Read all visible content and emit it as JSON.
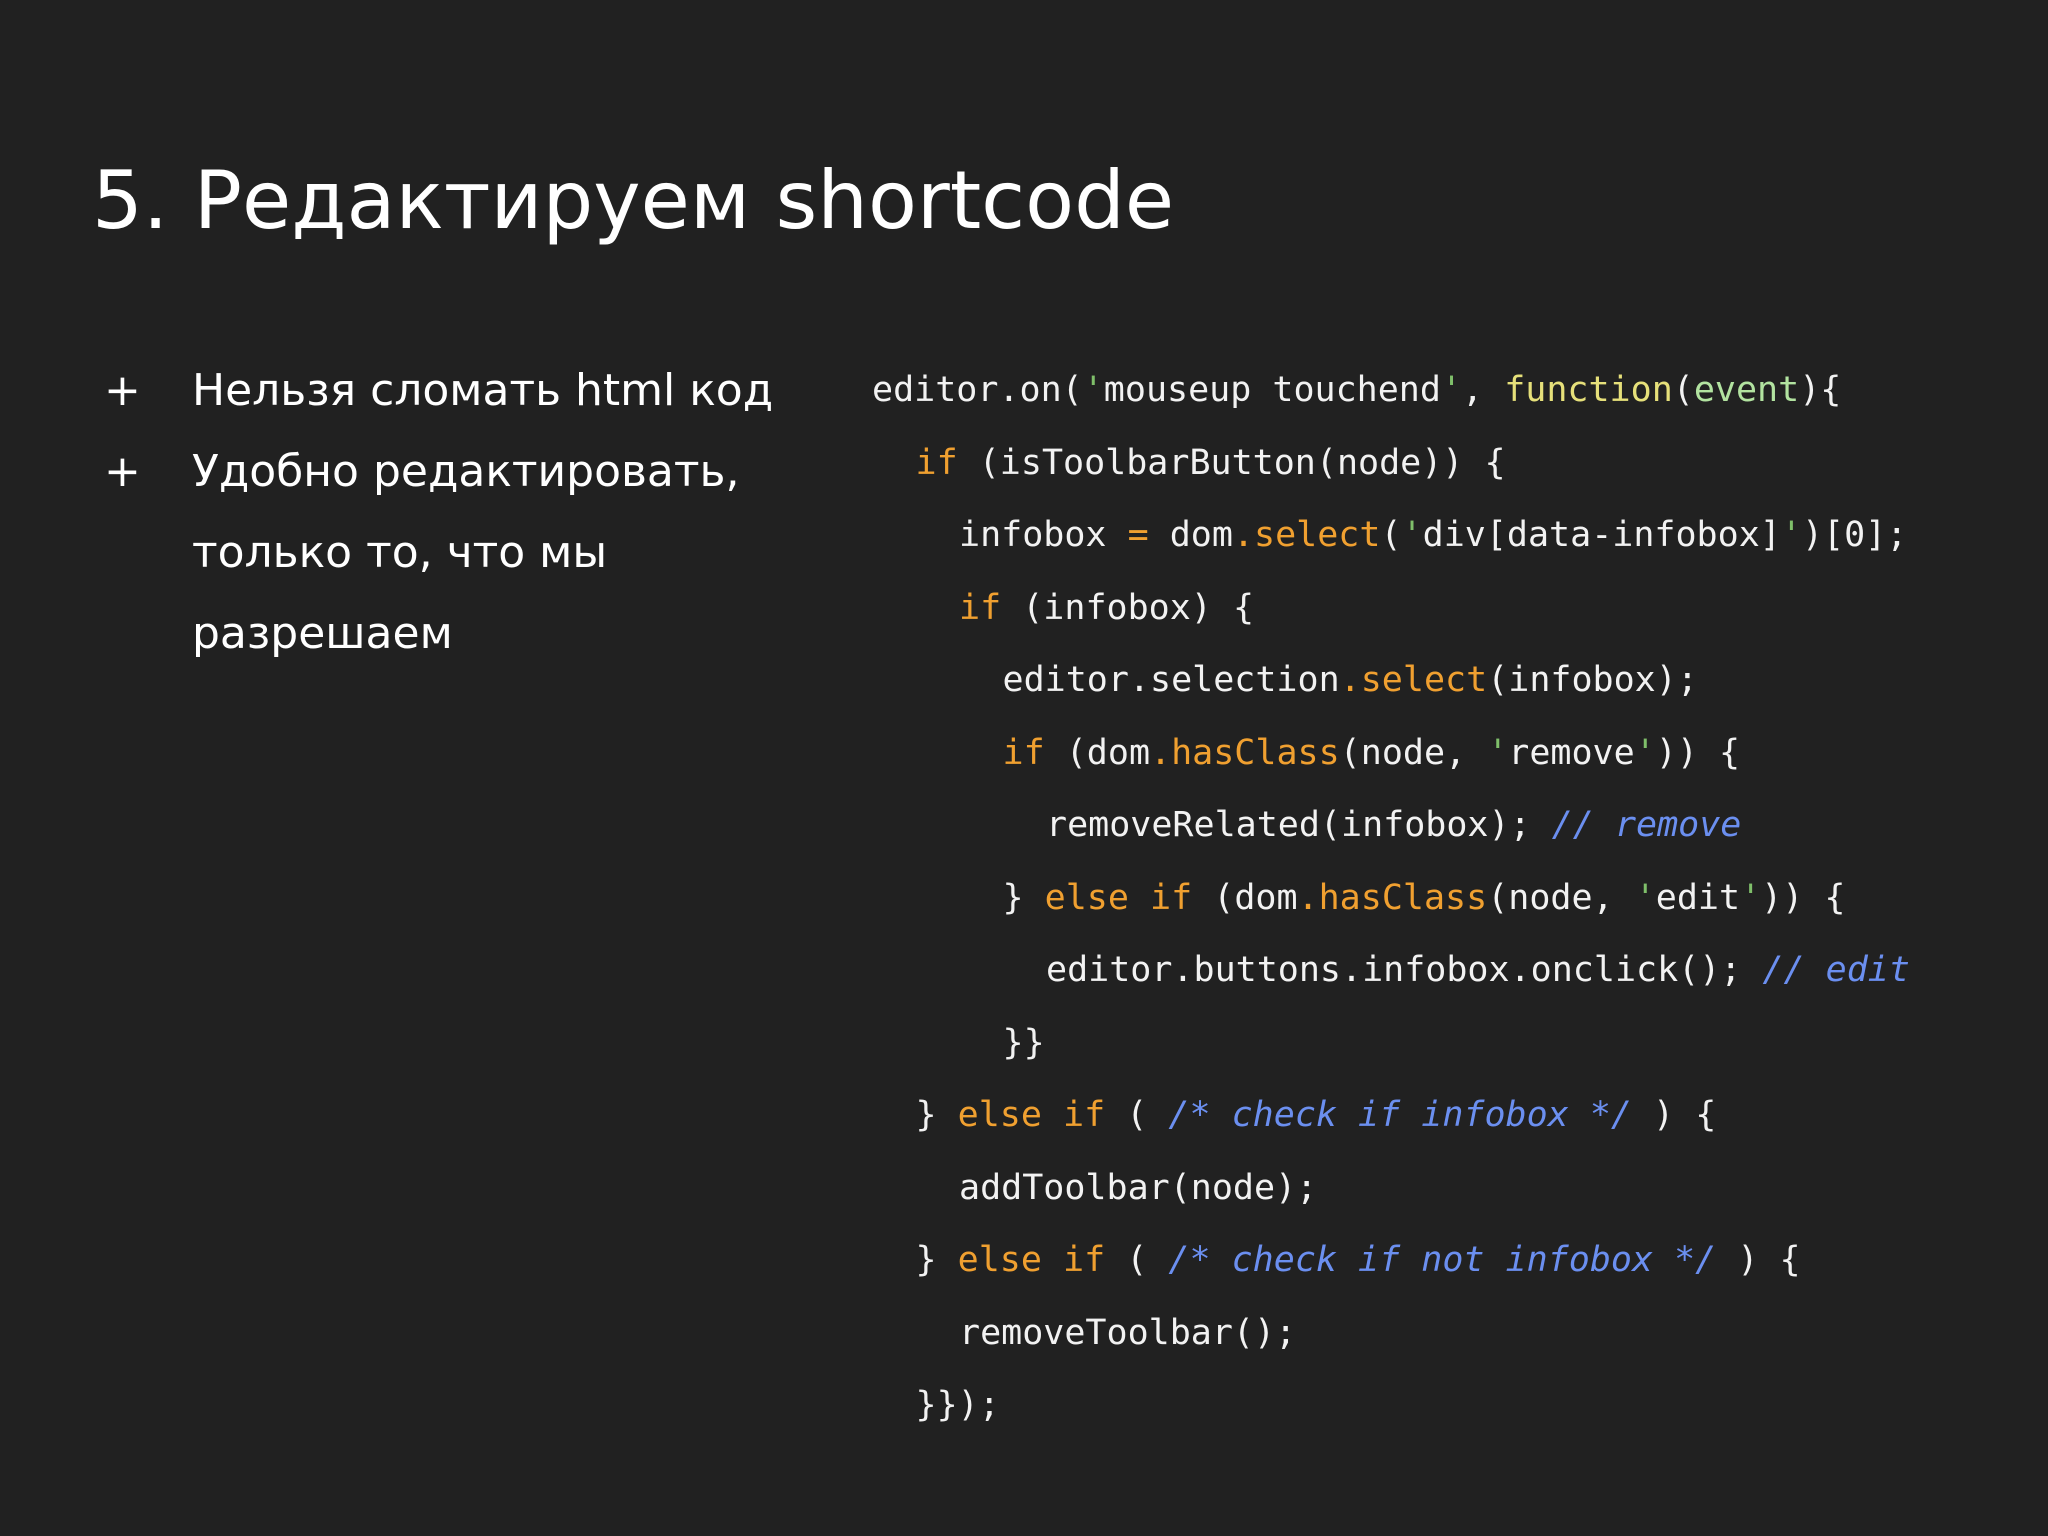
{
  "slide": {
    "title": "5. Редактируем shortcode"
  },
  "bullets": [
    {
      "marker": "+",
      "lines": [
        "Нельзя сломать html код"
      ]
    },
    {
      "marker": "+",
      "lines": [
        "Удобно редактировать,",
        "только то, что мы",
        "разрешаем"
      ]
    }
  ],
  "code": {
    "language": "javascript",
    "colors": {
      "background": "#212121",
      "text": "#f2f2f2",
      "keyword": "#f0a030",
      "string": "#7fbf6a",
      "function_keyword": "#e6e07a",
      "param": "#b2e3a0",
      "comment": "#6b8ff0"
    },
    "lines": [
      {
        "indent": 0,
        "tokens": [
          {
            "t": "plain",
            "v": "editor.on("
          },
          {
            "t": "string",
            "v": "'"
          },
          {
            "t": "plain",
            "v": "mouseup touchend"
          },
          {
            "t": "string",
            "v": "'"
          },
          {
            "t": "plain",
            "v": ", "
          },
          {
            "t": "function-keyword",
            "v": "function"
          },
          {
            "t": "plain",
            "v": "("
          },
          {
            "t": "param",
            "v": "event"
          },
          {
            "t": "plain",
            "v": "){"
          }
        ]
      },
      {
        "indent": 1,
        "tokens": [
          {
            "t": "keyword",
            "v": "if"
          },
          {
            "t": "plain",
            "v": " (isToolbarButton(node)) {"
          }
        ]
      },
      {
        "indent": 2,
        "tokens": [
          {
            "t": "plain",
            "v": "infobox "
          },
          {
            "t": "operator",
            "v": "="
          },
          {
            "t": "plain",
            "v": " dom"
          },
          {
            "t": "method",
            "v": ".select"
          },
          {
            "t": "plain",
            "v": "("
          },
          {
            "t": "string",
            "v": "'"
          },
          {
            "t": "plain",
            "v": "div[data-infobox]"
          },
          {
            "t": "string",
            "v": "'"
          },
          {
            "t": "plain",
            "v": ")[0];"
          }
        ]
      },
      {
        "indent": 2,
        "tokens": [
          {
            "t": "keyword",
            "v": "if"
          },
          {
            "t": "plain",
            "v": " (infobox) {"
          }
        ]
      },
      {
        "indent": 3,
        "tokens": [
          {
            "t": "plain",
            "v": "editor.selection"
          },
          {
            "t": "method",
            "v": ".select"
          },
          {
            "t": "plain",
            "v": "(infobox);"
          }
        ]
      },
      {
        "indent": 3,
        "tokens": [
          {
            "t": "keyword",
            "v": "if"
          },
          {
            "t": "plain",
            "v": " (dom"
          },
          {
            "t": "method",
            "v": ".hasClass"
          },
          {
            "t": "plain",
            "v": "(node, "
          },
          {
            "t": "string",
            "v": "'"
          },
          {
            "t": "plain",
            "v": "remove"
          },
          {
            "t": "string",
            "v": "'"
          },
          {
            "t": "plain",
            "v": ")) {"
          }
        ]
      },
      {
        "indent": 4,
        "tokens": [
          {
            "t": "plain",
            "v": "removeRelated(infobox); "
          },
          {
            "t": "comment",
            "v": "// remove"
          }
        ]
      },
      {
        "indent": 3,
        "tokens": [
          {
            "t": "plain",
            "v": "} "
          },
          {
            "t": "keyword",
            "v": "else if"
          },
          {
            "t": "plain",
            "v": " (dom"
          },
          {
            "t": "method",
            "v": ".hasClass"
          },
          {
            "t": "plain",
            "v": "(node, "
          },
          {
            "t": "string",
            "v": "'"
          },
          {
            "t": "plain",
            "v": "edit"
          },
          {
            "t": "string",
            "v": "'"
          },
          {
            "t": "plain",
            "v": ")) {"
          }
        ]
      },
      {
        "indent": 4,
        "tokens": [
          {
            "t": "plain",
            "v": "editor.buttons.infobox.onclick(); "
          },
          {
            "t": "comment",
            "v": "// edit"
          }
        ]
      },
      {
        "indent": 3,
        "tokens": [
          {
            "t": "plain",
            "v": "}}"
          }
        ]
      },
      {
        "indent": 1,
        "tokens": [
          {
            "t": "plain",
            "v": "} "
          },
          {
            "t": "keyword",
            "v": "else if"
          },
          {
            "t": "plain",
            "v": " ( "
          },
          {
            "t": "comment",
            "v": "/* check if infobox */"
          },
          {
            "t": "plain",
            "v": " ) {"
          }
        ]
      },
      {
        "indent": 2,
        "tokens": [
          {
            "t": "plain",
            "v": "addToolbar(node);"
          }
        ]
      },
      {
        "indent": 1,
        "tokens": [
          {
            "t": "plain",
            "v": "} "
          },
          {
            "t": "keyword",
            "v": "else if"
          },
          {
            "t": "plain",
            "v": " ( "
          },
          {
            "t": "comment",
            "v": "/* check if not infobox */"
          },
          {
            "t": "plain",
            "v": " ) {"
          }
        ]
      },
      {
        "indent": 2,
        "tokens": [
          {
            "t": "plain",
            "v": "removeToolbar();"
          }
        ]
      },
      {
        "indent": 1,
        "tokens": [
          {
            "t": "plain",
            "v": "}});"
          }
        ]
      }
    ]
  }
}
